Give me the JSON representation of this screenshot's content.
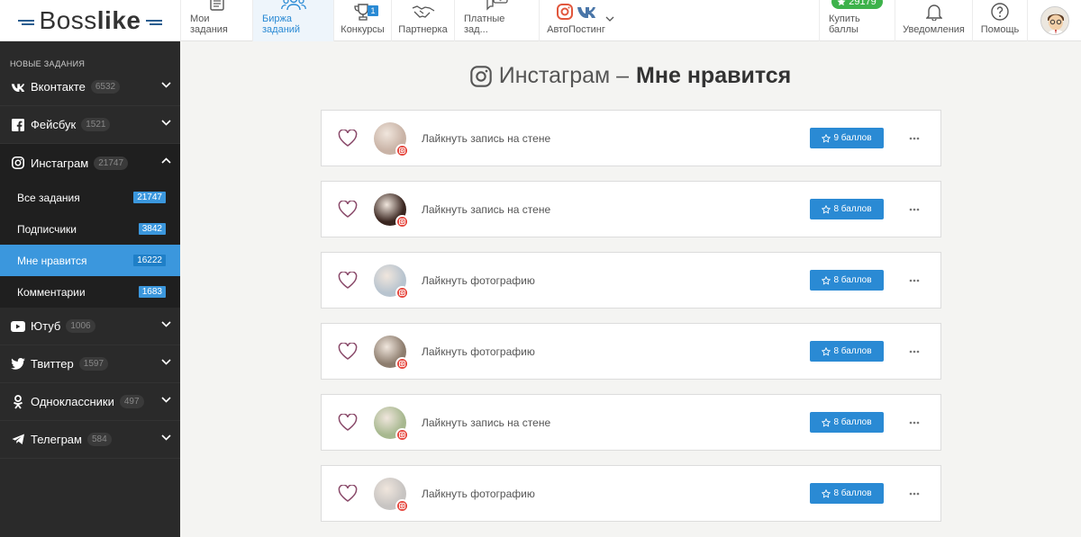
{
  "logo": {
    "text_a": "Boss",
    "text_b": "like"
  },
  "nav": {
    "items": [
      {
        "label": "Мои задания",
        "icon": "clipboard-icon"
      },
      {
        "label": "Биржа заданий",
        "icon": "users-icon"
      },
      {
        "label": "Конкурсы",
        "icon": "trophy-icon",
        "badge": "1"
      },
      {
        "label": "Партнерка",
        "icon": "handshake-icon"
      },
      {
        "label": "Платные зад...",
        "icon": "paid-chat-icon"
      },
      {
        "label": "АвтоПостинг",
        "icon": "instagram-vk-icon"
      }
    ],
    "points": "29179",
    "buy_label": "Купить баллы",
    "notifications_label": "Уведомления",
    "help_label": "Помощь"
  },
  "sidebar": {
    "title": "Новые задания",
    "groups": [
      {
        "label": "Вконтакте",
        "count": "6532",
        "icon": "vk-icon"
      },
      {
        "label": "Фейсбук",
        "count": "1521",
        "icon": "facebook-icon"
      },
      {
        "label": "Инстаграм",
        "count": "21747",
        "icon": "instagram-icon"
      },
      {
        "label": "Ютуб",
        "count": "1006",
        "icon": "youtube-icon"
      },
      {
        "label": "Твиттер",
        "count": "1597",
        "icon": "twitter-icon"
      },
      {
        "label": "Одноклассники",
        "count": "497",
        "icon": "odnoklassniki-icon"
      },
      {
        "label": "Телеграм",
        "count": "584",
        "icon": "telegram-icon"
      }
    ],
    "instagram_sub": [
      {
        "label": "Все задания",
        "count": "21747"
      },
      {
        "label": "Подписчики",
        "count": "3842"
      },
      {
        "label": "Мне нравится",
        "count": "16222"
      },
      {
        "label": "Комментарии",
        "count": "1683"
      }
    ]
  },
  "main": {
    "title_prefix": "Инстаграм –",
    "title_bold": "Мне нравится",
    "tasks": [
      {
        "label": "Лайкнуть запись на стене",
        "points": "9 баллов",
        "avatar_color": "#c9b3a6"
      },
      {
        "label": "Лайкнуть запись на стене",
        "points": "8 баллов",
        "avatar_color": "#3a2620"
      },
      {
        "label": "Лайкнуть фотографию",
        "points": "8 баллов",
        "avatar_color": "#b8c4cf"
      },
      {
        "label": "Лайкнуть фотографию",
        "points": "8 баллов",
        "avatar_color": "#8d7d6e"
      },
      {
        "label": "Лайкнуть запись на стене",
        "points": "8 баллов",
        "avatar_color": "#a7b88f"
      },
      {
        "label": "Лайкнуть фотографию",
        "points": "8 баллов",
        "avatar_color": "#c7c4c2"
      }
    ]
  },
  "colors": {
    "accent": "#2a8ad4",
    "sidebar_bg": "#2a2a2a",
    "active": "#3b97dd",
    "points_green": "#3db24b"
  }
}
